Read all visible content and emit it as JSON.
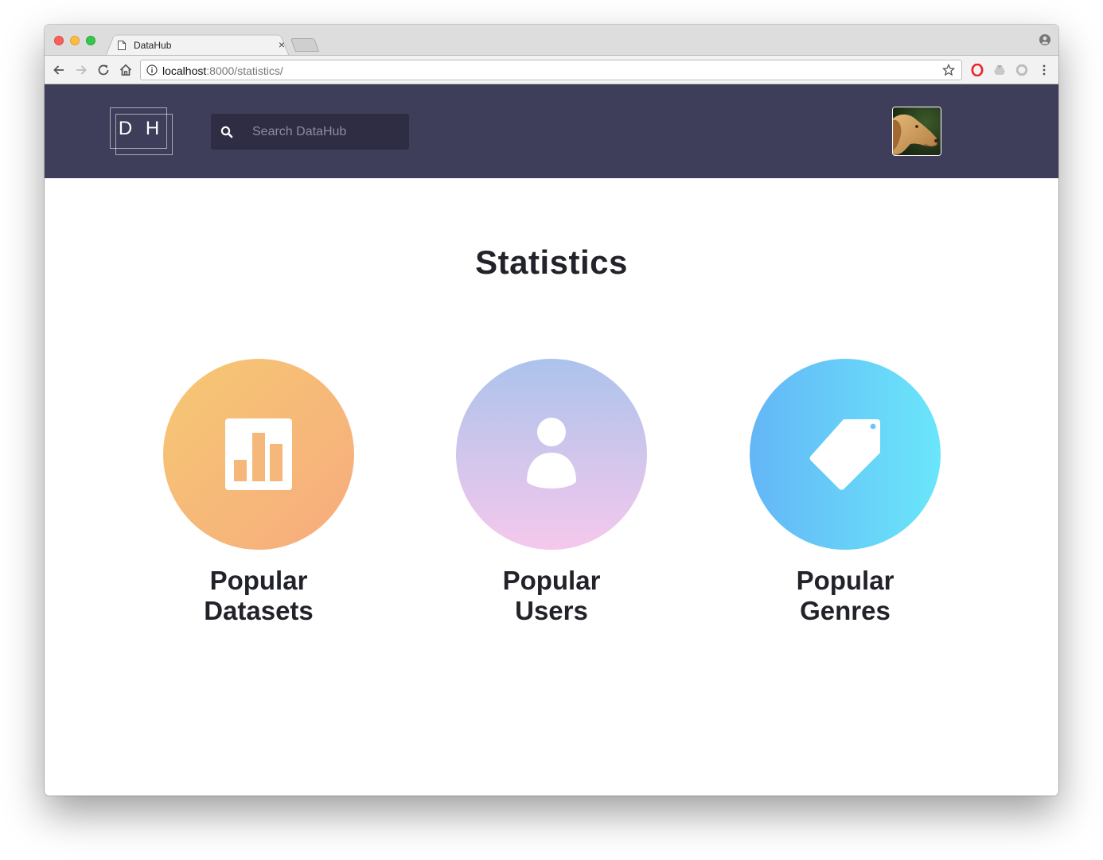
{
  "browser": {
    "tab_title": "DataHub",
    "tab_close": "×",
    "url_host": "localhost",
    "url_rest": ":8000/statistics/"
  },
  "header": {
    "logo_text": "DH",
    "search_placeholder": "Search DataHub",
    "search_value": "",
    "background_color": "#3f3e5a"
  },
  "main": {
    "title": "Statistics",
    "cards": [
      {
        "label": "Popular Datasets",
        "icon": "bar-chart-icon",
        "gradient": [
          "#f6c873",
          "#f7ab7e"
        ]
      },
      {
        "label": "Popular Users",
        "icon": "user-icon",
        "gradient": [
          "#acc3ec",
          "#f5c8ec"
        ]
      },
      {
        "label": "Popular Genres",
        "icon": "tag-icon",
        "gradient": [
          "#64b6f6",
          "#6ae6fa"
        ]
      }
    ]
  }
}
